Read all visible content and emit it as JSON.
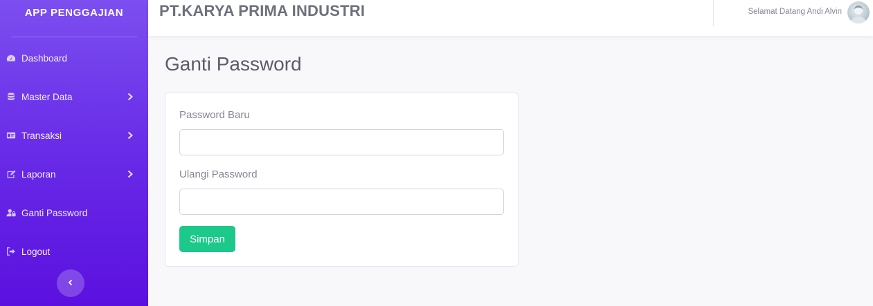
{
  "sidebar": {
    "brand": "APP PENGGAJIAN",
    "items": [
      {
        "label": "Dashboard",
        "icon": "tachometer-icon",
        "has_submenu": false
      },
      {
        "label": "Master Data",
        "icon": "database-icon",
        "has_submenu": true
      },
      {
        "label": "Transaksi",
        "icon": "id-card-icon",
        "has_submenu": true
      },
      {
        "label": "Laporan",
        "icon": "edit-icon",
        "has_submenu": true
      },
      {
        "label": "Ganti Password",
        "icon": "user-lock-icon",
        "has_submenu": false
      },
      {
        "label": "Logout",
        "icon": "sign-out-icon",
        "has_submenu": false
      }
    ],
    "toggle_icon": "chevron-left-icon"
  },
  "topbar": {
    "company": "PT.KARYA PRIMA INDUSTRI",
    "welcome": "Selamat Datang Andi Alvin",
    "avatar_icon": "user-avatar"
  },
  "main": {
    "title": "Ganti Password",
    "form": {
      "new_password_label": "Password Baru",
      "new_password_value": "",
      "repeat_password_label": "Ulangi Password",
      "repeat_password_value": "",
      "submit_label": "Simpan"
    }
  },
  "colors": {
    "sidebar_top": "#7c4ff0",
    "sidebar_bottom": "#5b10df",
    "success": "#1cc88a",
    "text_muted": "#858796"
  }
}
